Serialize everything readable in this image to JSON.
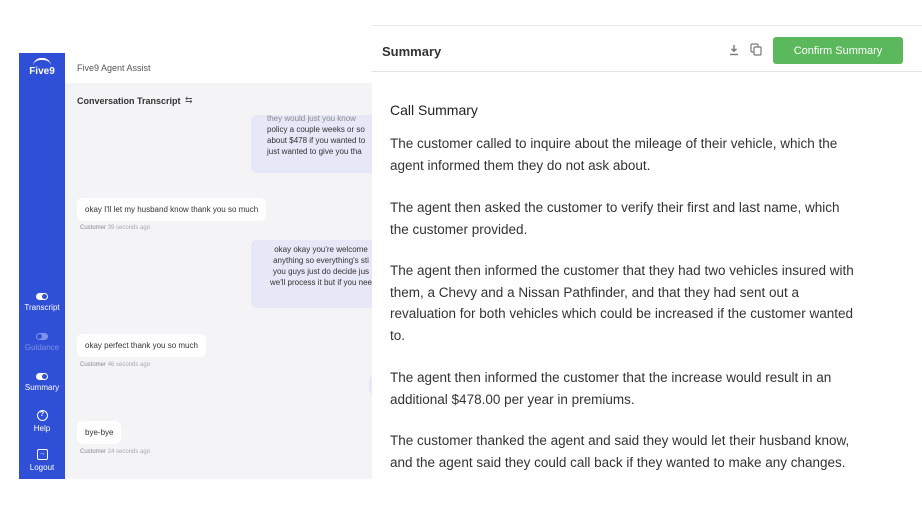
{
  "app": {
    "logo": "Five9",
    "title": "Five9 Agent Assist",
    "section_title": "Conversation Transcript",
    "nav": [
      {
        "label": "Transcript",
        "icon": "toggle-on-icon",
        "enabled": true
      },
      {
        "label": "Guidance",
        "icon": "toggle-off-icon",
        "enabled": false
      },
      {
        "label": "Summary",
        "icon": "toggle-on-icon",
        "enabled": true
      },
      {
        "label": "Help",
        "icon": "help-icon",
        "enabled": true
      },
      {
        "label": "Logout",
        "icon": "logout-icon",
        "enabled": true
      }
    ],
    "messages": [
      {
        "speaker": "agent",
        "lines": [
          "they would just you know",
          "policy a couple weeks or so",
          "about $478 if you wanted to",
          "just wanted to give you tha"
        ]
      },
      {
        "speaker": "customer",
        "text": "okay I'll let my husband know thank you so much",
        "who": "Customer",
        "ago": "39 seconds ago"
      },
      {
        "speaker": "agent",
        "lines": [
          "okay okay you're welcome",
          "anything so everything's sti",
          "you guys just do decide jus",
          "we'll process it but if you nee"
        ]
      },
      {
        "speaker": "customer",
        "text": "okay perfect thank you so much",
        "who": "Customer",
        "ago": "46 seconds ago"
      },
      {
        "speaker": "customer",
        "text": "bye-bye",
        "who": "Customer",
        "ago": "24 seconds ago"
      }
    ]
  },
  "panel": {
    "title": "Summary",
    "confirm_label": "Confirm Summary",
    "heading": "Call Summary",
    "paragraphs": [
      "The customer called to inquire about the mileage of their vehicle, which the agent informed them they do not ask about.",
      "The agent then asked the customer to verify their first and last name, which the customer provided.",
      "The agent then informed the customer that they had two vehicles insured with them, a Chevy and a Nissan Pathfinder, and that they had sent out a revaluation for both vehicles which could be increased if the customer wanted to.",
      "The agent then informed the customer that the increase would result in an additional $478.00 per year in premiums.",
      "The customer thanked the agent and said they would let their husband know, and the agent said they could call back if they wanted to make any changes."
    ],
    "colors": {
      "confirm_button": "#5cb85c",
      "sidebar": "#2f4fd6"
    }
  }
}
